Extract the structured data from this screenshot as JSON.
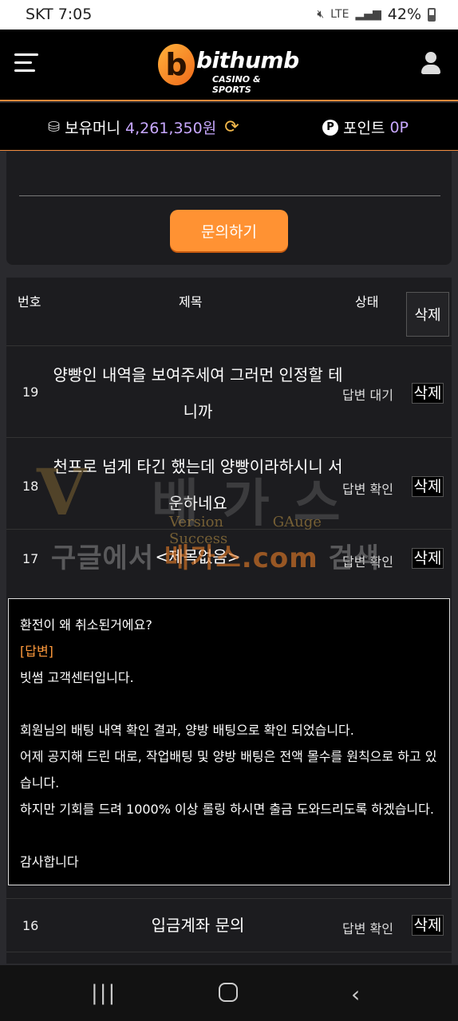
{
  "status_bar": {
    "carrier_time": "SKT 7:05",
    "network": "LTE",
    "battery": "42%"
  },
  "header": {
    "logo_text": "bithumb",
    "logo_tagline": "CASINO & SPORTS",
    "logo_mark": "b"
  },
  "balance": {
    "money_label": "보유머니",
    "money_value": "4,261,350원",
    "point_badge": "P",
    "point_label": "포인트",
    "point_value": "0P"
  },
  "inquiry": {
    "button_label": "문의하기"
  },
  "table": {
    "headers": {
      "no": "번호",
      "title": "제목",
      "status": "상태",
      "delete": "삭제"
    },
    "rows": [
      {
        "no": "19",
        "title": "양빵인 내역을 보여주세여 그러먼 인정할 테니까",
        "status": "답변 대기",
        "delete": "삭제"
      },
      {
        "no": "18",
        "title": "천프로 넘게 타긴 했는데 양빵이라하시니 서운하네요",
        "status": "답변 확인",
        "delete": "삭제"
      },
      {
        "no": "17",
        "title": "<제목없음>",
        "status": "답변 확인",
        "delete": "삭제"
      },
      {
        "no": "16",
        "title": "입금계좌 문의",
        "status": "답변 확인",
        "delete": "삭제"
      }
    ]
  },
  "answer": {
    "question": "환전이 왜 취소된거에요?",
    "tag": "[답변]",
    "lines": [
      "빗썸 고객센터입니다.",
      "",
      "회원님의 배팅 내역 확인 결과, 양방 배팅으로 확인 되었습니다.",
      "어제 공지해 드린 대로, 작업배팅 및 양방 배팅은 전액 몰수를 원칙으로 하고 있습니다.",
      "하지만 기회를 드려 1000% 이상 롤링 하시면 출금 도와드리도록 하겠습니다.",
      "",
      "감사합니다"
    ]
  },
  "watermark": {
    "mark": "V",
    "big": "배가스",
    "word1": "Version",
    "word2": "GAuge",
    "word3": "Success",
    "search_pre": "구글에서 ",
    "search_hl": "배가스.com",
    "search_post": " 검색"
  }
}
